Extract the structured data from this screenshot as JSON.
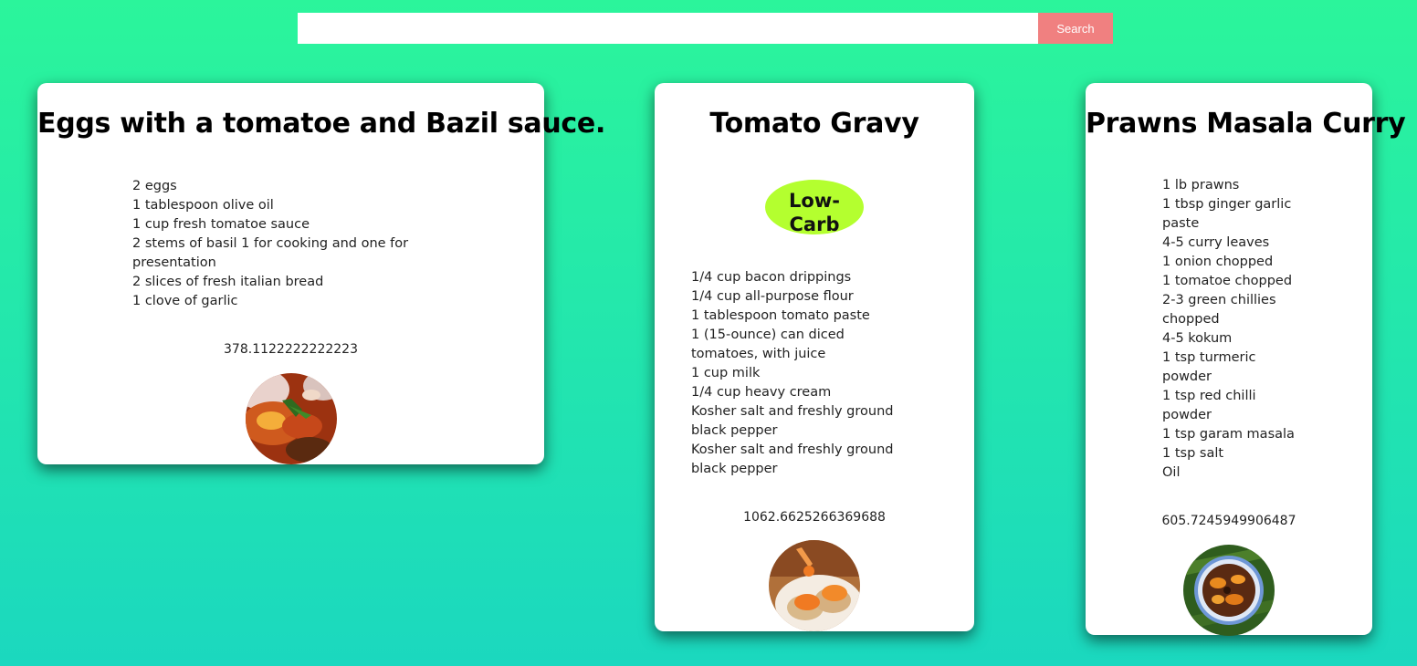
{
  "search": {
    "value": "",
    "placeholder": "",
    "button_label": "Search"
  },
  "colors": {
    "background_top": "#2bf59b",
    "background_bottom": "#1bd8bf",
    "search_button": "#f08080",
    "diet_badge": "#b4ff2f",
    "card": "#ffffff"
  },
  "recipes": [
    {
      "title": "Eggs with a tomatoe and Bazil sauce.",
      "diet_label": "",
      "ingredients": [
        "2 eggs",
        "1 tablespoon olive oil",
        "1 cup fresh tomatoe sauce",
        "2 stems of basil 1 for cooking and one for presentation",
        "2 slices of fresh italian bread",
        "1 clove of garlic"
      ],
      "calories": "378.1122222222223",
      "image_icon": "eggs-tomato-sauce-photo"
    },
    {
      "title": "Tomato Gravy",
      "diet_label": "Low-Carb",
      "ingredients": [
        "1/4 cup bacon drippings",
        "1/4 cup all-purpose flour",
        "1 tablespoon tomato paste",
        "1 (15-ounce) can diced tomatoes, with juice",
        "1 cup milk",
        "1/4 cup heavy cream",
        "Kosher salt and freshly ground black pepper",
        "Kosher salt and freshly ground black pepper"
      ],
      "calories": "1062.6625266369688",
      "image_icon": "tomato-gravy-biscuits-photo"
    },
    {
      "title": "Prawns Masala Curry",
      "diet_label": "",
      "ingredients": [
        "1 lb prawns",
        "1 tbsp ginger garlic paste",
        "4-5 curry leaves",
        "1 onion chopped",
        "1 tomatoe chopped",
        "2-3 green chillies chopped",
        "4-5 kokum",
        "1 tsp turmeric powder",
        "1 tsp red chilli powder",
        "1 tsp garam masala",
        "1 tsp salt",
        "Oil"
      ],
      "calories": "605.7245949906487",
      "image_icon": "prawns-masala-bowl-photo"
    }
  ]
}
